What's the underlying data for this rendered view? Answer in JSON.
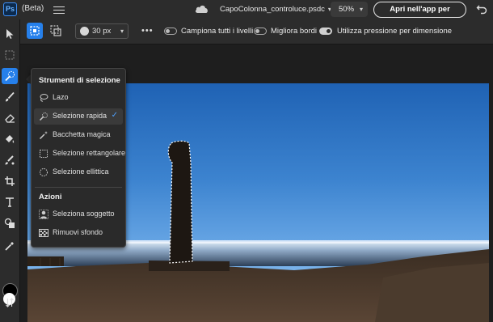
{
  "app": {
    "logo_text": "Ps",
    "badge": "(Beta)"
  },
  "document": {
    "filename": "CapoColonna_controluce.psdc",
    "zoom": "50%"
  },
  "header": {
    "open_desktop_label": "Apri nell'app per desktop"
  },
  "options": {
    "brush_size": "30 px",
    "toggles": [
      {
        "label": "Campiona tutti i livelli",
        "on": false
      },
      {
        "label": "Migliora bordi",
        "on": false
      },
      {
        "label": "Utilizza pressione per dimensione",
        "on": true
      }
    ]
  },
  "selection_menu": {
    "section_title": "Strumenti di selezione",
    "items": [
      {
        "label": "Lazo",
        "icon": "lasso-icon",
        "selected": false
      },
      {
        "label": "Selezione rapida",
        "icon": "quick-selection-icon",
        "selected": true
      },
      {
        "label": "Bacchetta magica",
        "icon": "magic-wand-icon",
        "selected": false
      },
      {
        "label": "Selezione rettangolare",
        "icon": "rectangular-marquee-icon",
        "selected": false
      },
      {
        "label": "Selezione ellittica",
        "icon": "elliptical-marquee-icon",
        "selected": false
      }
    ],
    "actions_title": "Azioni",
    "actions": [
      {
        "label": "Seleziona soggetto",
        "icon": "select-subject-icon"
      },
      {
        "label": "Rimuovi sfondo",
        "icon": "remove-background-icon"
      }
    ]
  },
  "colors": {
    "accent": "#2680eb",
    "foreground": "#000000",
    "background": "#ffffff"
  }
}
